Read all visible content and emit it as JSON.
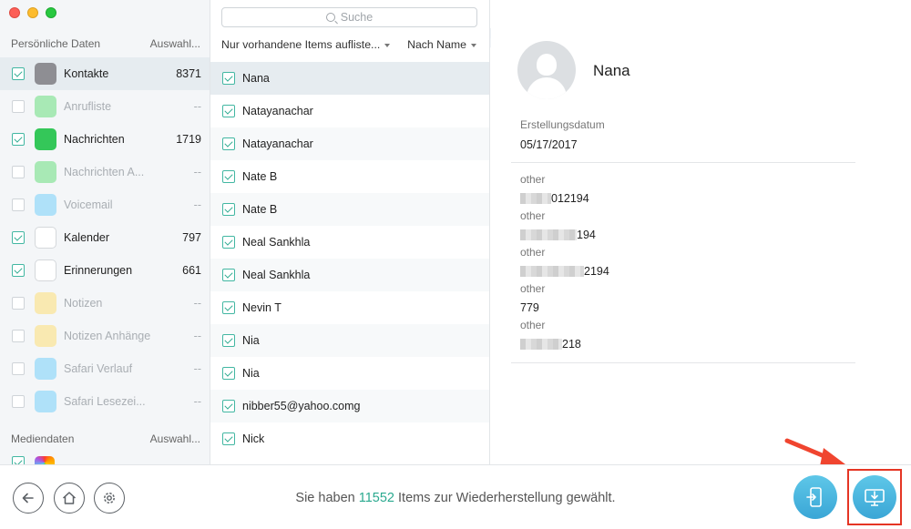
{
  "sidebar": {
    "section1": {
      "title": "Persönliche Daten",
      "action": "Auswahl..."
    },
    "categories": [
      {
        "label": "Kontakte",
        "count": "8371",
        "checked": true,
        "enabled": true,
        "icon": "contacts-icon",
        "color": "#8e8e93"
      },
      {
        "label": "Anrufliste",
        "count": "--",
        "checked": false,
        "enabled": false,
        "icon": "phone-icon",
        "color": "#4cd964"
      },
      {
        "label": "Nachrichten",
        "count": "1719",
        "checked": true,
        "enabled": true,
        "icon": "messages-icon",
        "color": "#34c759"
      },
      {
        "label": "Nachrichten A...",
        "count": "--",
        "checked": false,
        "enabled": false,
        "icon": "message-attachments-icon",
        "color": "#4cd964"
      },
      {
        "label": "Voicemail",
        "count": "--",
        "checked": false,
        "enabled": false,
        "icon": "voicemail-icon",
        "color": "#5ac8fa"
      },
      {
        "label": "Kalender",
        "count": "797",
        "checked": true,
        "enabled": true,
        "icon": "calendar-icon",
        "color": "#ffffff"
      },
      {
        "label": "Erinnerungen",
        "count": "661",
        "checked": true,
        "enabled": true,
        "icon": "reminders-icon",
        "color": "#ffffff"
      },
      {
        "label": "Notizen",
        "count": "--",
        "checked": false,
        "enabled": false,
        "icon": "notes-icon",
        "color": "#ffd95a"
      },
      {
        "label": "Notizen Anhänge",
        "count": "--",
        "checked": false,
        "enabled": false,
        "icon": "notes-attachments-icon",
        "color": "#ffd95a"
      },
      {
        "label": "Safari Verlauf",
        "count": "--",
        "checked": false,
        "enabled": false,
        "icon": "safari-history-icon",
        "color": "#5ac8fa"
      },
      {
        "label": "Safari Lesezei...",
        "count": "--",
        "checked": false,
        "enabled": false,
        "icon": "safari-bookmarks-icon",
        "color": "#5ac8fa"
      }
    ],
    "section2": {
      "title": "Mediendaten",
      "action": "Auswahl..."
    }
  },
  "list": {
    "search_placeholder": "Suche",
    "filter_label": "Nur vorhandene Items aufliste...",
    "sort_label": "Nach Name",
    "items": [
      "Nana",
      "Natayanachar",
      "Natayanachar",
      "Nate B",
      "Nate B",
      "Neal Sankhla",
      "Neal Sankhla",
      "Nevin T",
      "Nia",
      "Nia",
      "nibber55@yahoo.comg",
      "Nick"
    ]
  },
  "detail": {
    "name": "Nana",
    "created_label": "Erstellungsdatum",
    "created_value": "05/17/2017",
    "fields": [
      {
        "label": "other",
        "value": "012194"
      },
      {
        "label": "other",
        "value": "194"
      },
      {
        "label": "other",
        "value": "2194"
      },
      {
        "label": "other",
        "value": "779"
      },
      {
        "label": "other",
        "value": "218"
      }
    ]
  },
  "footer": {
    "status_prefix": "Sie haben ",
    "status_count": "11552",
    "status_suffix": " Items zur Wiederherstellung gewählt."
  },
  "colors": {
    "accent": "#2aa98f",
    "highlight": "#e53524",
    "button": "#3aa6d6"
  }
}
